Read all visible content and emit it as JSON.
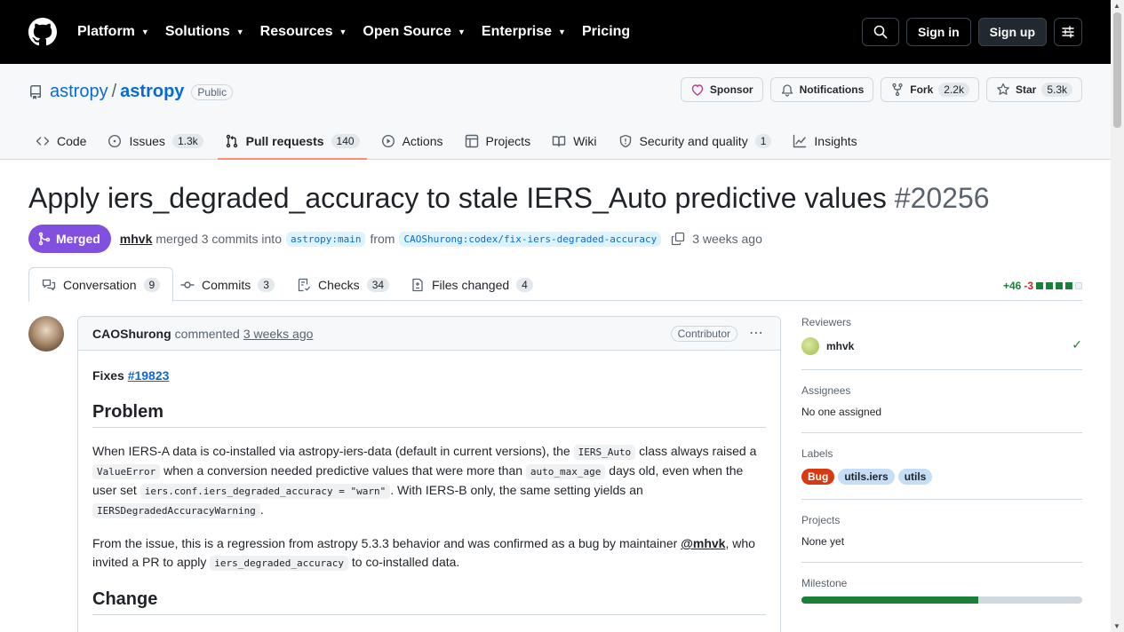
{
  "nav": {
    "items": [
      "Platform",
      "Solutions",
      "Resources",
      "Open Source",
      "Enterprise",
      "Pricing"
    ],
    "sign_in": "Sign in",
    "sign_up": "Sign up"
  },
  "repo": {
    "owner": "astropy",
    "separator": "/",
    "name": "astropy",
    "visibility": "Public",
    "sponsor": "Sponsor",
    "notifications": "Notifications",
    "fork_label": "Fork",
    "fork_count": "2.2k",
    "star_label": "Star",
    "star_count": "5.3k",
    "tabs": [
      {
        "label": "Code",
        "count": ""
      },
      {
        "label": "Issues",
        "count": "1.3k"
      },
      {
        "label": "Pull requests",
        "count": "140"
      },
      {
        "label": "Actions",
        "count": ""
      },
      {
        "label": "Projects",
        "count": ""
      },
      {
        "label": "Wiki",
        "count": ""
      },
      {
        "label": "Security and quality",
        "count": "1"
      },
      {
        "label": "Insights",
        "count": ""
      }
    ]
  },
  "pr": {
    "title": "Apply iers_degraded_accuracy to stale IERS_Auto predictive values",
    "number": "#20256",
    "state": "Merged",
    "author": "mhvk",
    "merged_text": "merged 3 commits into",
    "base_branch": "astropy:main",
    "from_text": "from",
    "head_branch": "CAOShurong:codex/fix-iers-degraded-accuracy",
    "time": "3 weeks ago",
    "tabs": [
      {
        "label": "Conversation",
        "count": "9"
      },
      {
        "label": "Commits",
        "count": "3"
      },
      {
        "label": "Checks",
        "count": "34"
      },
      {
        "label": "Files changed",
        "count": "4"
      }
    ],
    "additions": "+46",
    "deletions": "-3"
  },
  "comment": {
    "author": "CAOShurong",
    "action": "commented",
    "time": "3 weeks ago",
    "badge": "Contributor",
    "fixes_label": "Fixes",
    "fixes_link": "#19823",
    "h_problem": "Problem",
    "p1": {
      "t1": "When IERS-A data is co-installed via astropy-iers-data (default in current versions), the ",
      "c1": "IERS_Auto",
      "t2": " class always raised a ",
      "c2": "ValueError",
      "t3": " when a conversion needed predictive values that were more than ",
      "c3": "auto_max_age",
      "t4": " days old, even when the user set ",
      "c4": "iers.conf.iers_degraded_accuracy = \"warn\"",
      "t5": ". With IERS-B only, the same setting yields an ",
      "c5": "IERSDegradedAccuracyWarning",
      "t6": "."
    },
    "p2": {
      "t1": "From the issue, this is a regression from astropy 5.3.3 behavior and was confirmed as a bug by maintainer ",
      "mention": "@mhvk",
      "t2": ", who invited a PR to apply ",
      "c1": "iers_degraded_accuracy",
      "t3": " to co-installed data."
    },
    "h_change": "Change"
  },
  "sidebar": {
    "reviewers_heading": "Reviewers",
    "reviewer": "mhvk",
    "assignees_heading": "Assignees",
    "assignees_text": "No one assigned",
    "labels_heading": "Labels",
    "labels": [
      {
        "name": "Bug",
        "bg": "#d73a10",
        "fg": "#ffffff"
      },
      {
        "name": "utils.iers",
        "bg": "#c5def5",
        "fg": "#1f2328"
      },
      {
        "name": "utils",
        "bg": "#c5def5",
        "fg": "#1f2328"
      }
    ],
    "projects_heading": "Projects",
    "projects_text": "None yet",
    "milestone_heading": "Milestone",
    "milestone_progress": 0.63
  },
  "colors": {
    "merged": "#8250df",
    "link": "#0969da",
    "additions": "#1a7f37",
    "deletions": "#d1242f"
  }
}
